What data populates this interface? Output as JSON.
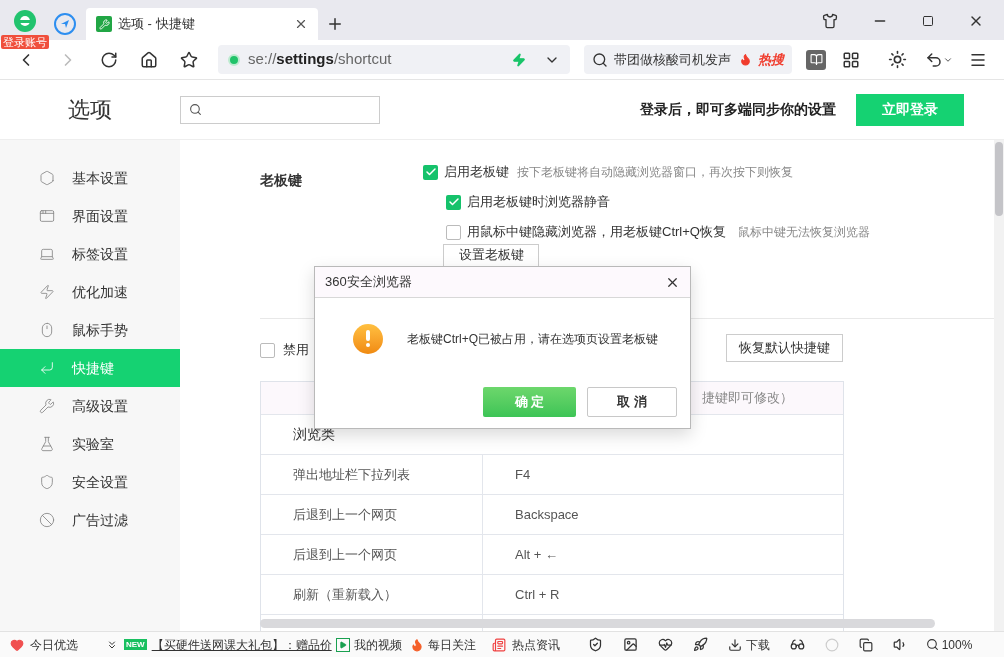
{
  "browser": {
    "account_badge": "登录账号",
    "tabs": [
      {
        "title": "选项 - 快捷键",
        "selected": true
      }
    ],
    "address": "se://**settings**/shortcut",
    "search": {
      "value": "带团做核酸司机发声",
      "badge": "热搜"
    }
  },
  "page": {
    "title": "选项",
    "login_prompt": "登录后，即可多端同步你的设置",
    "login_button": "立即登录"
  },
  "sidebar": {
    "items": [
      {
        "label": "基本设置",
        "selected": false
      },
      {
        "label": "界面设置",
        "selected": false
      },
      {
        "label": "标签设置",
        "selected": false
      },
      {
        "label": "优化加速",
        "selected": false
      },
      {
        "label": "鼠标手势",
        "selected": false
      },
      {
        "label": "快捷键",
        "selected": true
      },
      {
        "label": "高级设置",
        "selected": false
      },
      {
        "label": "实验室",
        "selected": false
      },
      {
        "label": "安全设置",
        "selected": false
      },
      {
        "label": "广告过滤",
        "selected": false
      }
    ]
  },
  "boss_key": {
    "label": "老板键",
    "option": {
      "label": "启用老板键",
      "hint": "按下老板键将自动隐藏浏览器窗口，再次按下则恢复",
      "checked": true,
      "children": [
        {
          "label": "启用老板键时浏览器静音",
          "checked": true
        },
        {
          "label": "用鼠标中键隐藏浏览器，用老板键Ctrl+Q恢复",
          "hint": "鼠标中键无法恢复浏览器",
          "checked": false
        }
      ]
    },
    "button": "设置老板键"
  },
  "shortcuts": {
    "disable": {
      "label": "禁用",
      "checked": false
    },
    "restore_button": "恢复默认快捷键",
    "header_note": "捷键即可修改）",
    "section": "浏览类",
    "rows": [
      {
        "action": "弹出地址栏下拉列表",
        "keys": "F4"
      },
      {
        "action": "后退到上一个网页",
        "keys": "Backspace"
      },
      {
        "action": "后退到上一个网页",
        "keys": "Alt + ←"
      },
      {
        "action": "刷新（重新载入）",
        "keys": "Ctrl + R"
      }
    ]
  },
  "dialog": {
    "title": "360安全浏览器",
    "message": "老板键Ctrl+Q已被占用，请在选项页设置老板键",
    "ok": "确 定",
    "cancel": "取 消"
  },
  "status_bar": {
    "today": "今日优选",
    "new_badge": "NEW",
    "promo": "【买硬件送网课大礼包】：赠品价",
    "video": "我的视频",
    "follow": "每日关注",
    "news": "热点资讯",
    "download": "下载",
    "zoom": "100%"
  }
}
